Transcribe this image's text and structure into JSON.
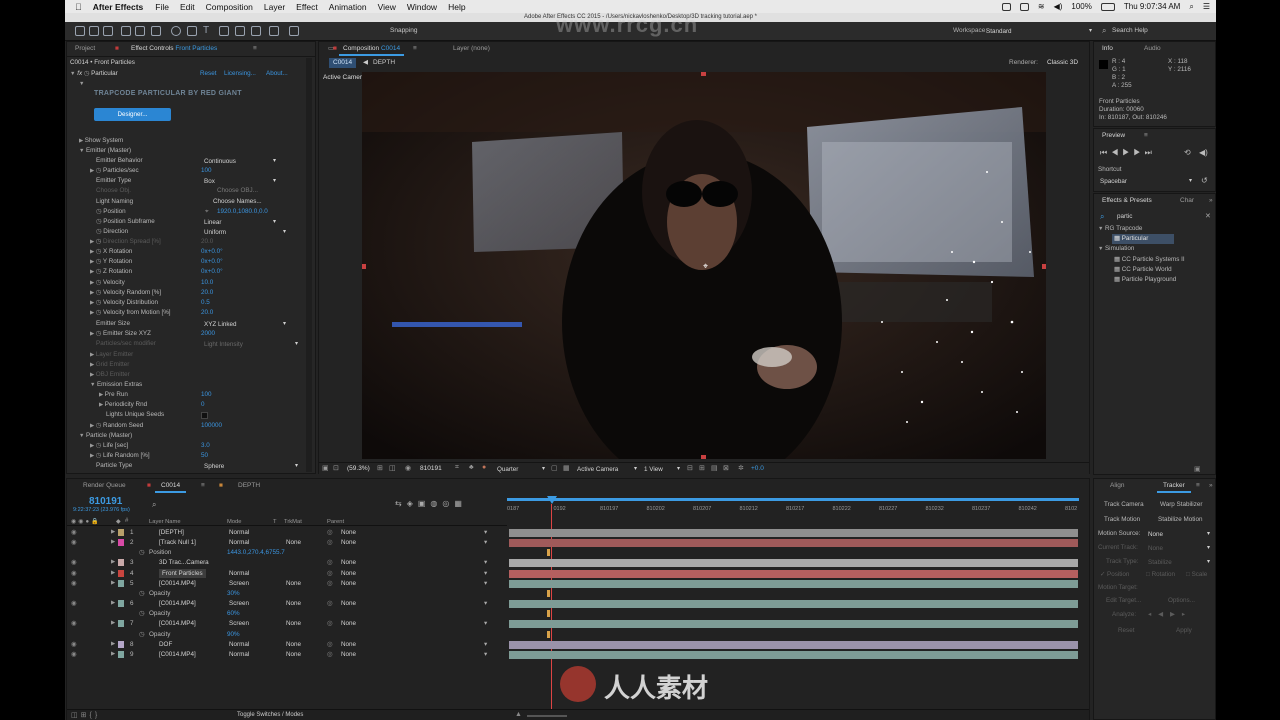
{
  "menubar": {
    "app_name": "After Effects",
    "items": [
      "File",
      "Edit",
      "Composition",
      "Layer",
      "Effect",
      "Animation",
      "View",
      "Window",
      "Help"
    ],
    "battery": "100%",
    "clock": "Thu 9:07:34 AM"
  },
  "window_title": "Adobe After Effects CC 2015 - /Users/nickavloshenko/Desktop/3D tracking tutorial.aep *",
  "watermark": "www.rrcg.cn",
  "toolbar": {
    "snapping_label": "Snapping",
    "workspace_label": "Workspace:",
    "workspace_value": "Standard",
    "search_help": "Search Help"
  },
  "left_panel": {
    "tab_project": "Project",
    "tab_effect_controls": "Effect Controls",
    "tab_effect_target": "Front Particles",
    "breadcrumb": "C0014 • Front Particles",
    "effect_name": "Particular",
    "reset": "Reset",
    "licensing": "Licensing...",
    "about": "About...",
    "brand": "TRAPCODE PARTICULAR BY RED GIANT",
    "designer_button": "Designer...",
    "show_system": "Show System",
    "emitter_master": "Emitter (Master)",
    "emitter_behavior": {
      "label": "Emitter Behavior",
      "value": "Continuous"
    },
    "particles_sec": {
      "label": "Particles/sec",
      "value": "100"
    },
    "emitter_type": {
      "label": "Emitter Type",
      "value": "Box"
    },
    "choose_obj_label": "Choose Obj.",
    "choose_obj_value": "Choose OBJ...",
    "light_naming": "Light Naming",
    "choose_names": "Choose Names...",
    "position": {
      "label": "Position",
      "value": "1920.0,1080.0,0.0"
    },
    "position_subframe": {
      "label": "Position Subframe",
      "value": "Linear"
    },
    "direction": {
      "label": "Direction",
      "value": "Uniform"
    },
    "direction_spread": {
      "label": "Direction Spread [%]",
      "value": "20.0"
    },
    "x_rotation": {
      "label": "X Rotation",
      "value": "0x+0.0°"
    },
    "y_rotation": {
      "label": "Y Rotation",
      "value": "0x+0.0°"
    },
    "z_rotation": {
      "label": "Z Rotation",
      "value": "0x+0.0°"
    },
    "velocity": {
      "label": "Velocity",
      "value": "10.0"
    },
    "velocity_random": {
      "label": "Velocity Random [%]",
      "value": "20.0"
    },
    "velocity_distribution": {
      "label": "Velocity Distribution",
      "value": "0.5"
    },
    "velocity_from_motion": {
      "label": "Velocity from Motion [%]",
      "value": "20.0"
    },
    "emitter_size": {
      "label": "Emitter Size",
      "value": "XYZ Linked"
    },
    "emitter_size_xyz": {
      "label": "Emitter Size XYZ",
      "value": "2000"
    },
    "particles_modifier": {
      "label": "Particles/sec modifier",
      "value": "Light Intensity"
    },
    "layer_emitter": "Layer Emitter",
    "grid_emitter": "Grid Emitter",
    "obj_emitter": "OBJ Emitter",
    "emission_extras": "Emission Extras",
    "pre_run": {
      "label": "Pre Run",
      "value": "100"
    },
    "periodicity_rnd": {
      "label": "Periodicity Rnd",
      "value": "0"
    },
    "lights_unique_seeds": "Lights Unique Seeds",
    "random_seed": {
      "label": "Random Seed",
      "value": "100000"
    },
    "particle_master": "Particle (Master)",
    "life_sec": {
      "label": "Life [sec]",
      "value": "3.0"
    },
    "life_random": {
      "label": "Life Random [%]",
      "value": "50"
    },
    "particle_type": {
      "label": "Particle Type",
      "value": "Sphere"
    }
  },
  "comp_panel": {
    "tab_label": "Composition",
    "tab_comp": "C0014",
    "layer_tab": "Layer (none)",
    "crumb_c0014": "C0014",
    "crumb_depth": "DEPTH",
    "renderer_label": "Renderer:",
    "renderer_value": "Classic 3D",
    "active_camera": "Active Camera",
    "zoom": "(59.3%)",
    "timecode": "810191",
    "resolution": "Quarter",
    "camera_select": "Active Camera",
    "views": "1 View",
    "exposure": "+0.0"
  },
  "info_panel": {
    "tab_info": "Info",
    "tab_audio": "Audio",
    "r": "R : 4",
    "g": "G : 1",
    "b": "B : 2",
    "a": "A : 255",
    "x": "X : 118",
    "y": "Y : 2116",
    "layer_name": "Front Particles",
    "duration": "Duration: 00060",
    "in_out": "In: 810187, Out: 810246"
  },
  "preview_panel": {
    "title": "Preview",
    "shortcut_label": "Shortcut",
    "shortcut_value": "Spacebar"
  },
  "effects_presets": {
    "tab_label": "Effects & Presets",
    "tab_char": "Char",
    "search": "partic",
    "group1": "RG Trapcode",
    "item_particular": "Particular",
    "group2": "Simulation",
    "items": [
      "CC Particle Systems II",
      "CC Particle World",
      "Particle Playground"
    ]
  },
  "tracker_panel": {
    "tab_align": "Align",
    "tab_tracker": "Tracker",
    "track_camera": "Track Camera",
    "warp_stabilizer": "Warp Stabilizer",
    "track_motion": "Track Motion",
    "stabilize_motion": "Stabilize Motion",
    "motion_source_label": "Motion Source:",
    "motion_source_value": "None",
    "current_track_label": "Current Track:",
    "current_track_value": "None",
    "track_type_label": "Track Type:",
    "track_type_value": "Stabilize",
    "position": "Position",
    "rotation": "Rotation",
    "scale": "Scale",
    "motion_target": "Motion Target:",
    "edit_target": "Edit Target...",
    "options": "Options...",
    "analyze": "Analyze:",
    "reset": "Reset",
    "apply": "Apply"
  },
  "timeline": {
    "tab_render_queue": "Render Queue",
    "tab_c0014": "C0014",
    "tab_depth": "DEPTH",
    "timecode": "810191",
    "sub_timecode": "9:22:37:23 (23.976 fps)",
    "col_layer_name": "Layer Name",
    "col_mode": "Mode",
    "col_t": "T",
    "col_trkmat": "TrkMat",
    "col_parent": "Parent",
    "toggle_label": "Toggle Switches / Modes",
    "ruler": [
      "0187",
      "0192",
      "810197",
      "810202",
      "810207",
      "810212",
      "810217",
      "810222",
      "810227",
      "810232",
      "810237",
      "810242",
      "8102"
    ],
    "layers": [
      {
        "num": "1",
        "name": "[DEPTH]",
        "mode": "Normal",
        "trkmat": "",
        "parent": "None",
        "color": "#b8a06a",
        "bar": "#8f8f8f"
      },
      {
        "num": "2",
        "name": "[Track Null 1]",
        "mode": "Normal",
        "trkmat": "None",
        "parent": "None",
        "color": "#d84aa6",
        "bar": "#a05a5a"
      },
      {
        "prop": "Position",
        "value": "1443.0,270.4,6755.7"
      },
      {
        "num": "3",
        "name": "3D Trac...Camera",
        "mode": "",
        "trkmat": "",
        "parent": "None",
        "color": "#c9a9a9",
        "bar": "#a8a8a8"
      },
      {
        "num": "4",
        "name": "Front Particles",
        "mode": "Normal",
        "trkmat": "",
        "parent": "None",
        "color": "#c9453f",
        "bar": "#b55f5f"
      },
      {
        "num": "5",
        "name": "[C0014.MP4]",
        "mode": "Screen",
        "trkmat": "None",
        "parent": "None",
        "color": "#7fa6a0",
        "bar": "#7e9c96"
      },
      {
        "prop": "Opacity",
        "value": "30%"
      },
      {
        "num": "6",
        "name": "[C0014.MP4]",
        "mode": "Screen",
        "trkmat": "None",
        "parent": "None",
        "color": "#7fa6a0",
        "bar": "#7e9c96"
      },
      {
        "prop": "Opacity",
        "value": "60%"
      },
      {
        "num": "7",
        "name": "[C0014.MP4]",
        "mode": "Screen",
        "trkmat": "None",
        "parent": "None",
        "color": "#7fa6a0",
        "bar": "#7e9c96"
      },
      {
        "prop": "Opacity",
        "value": "90%"
      },
      {
        "num": "8",
        "name": "DOF",
        "mode": "Normal",
        "trkmat": "None",
        "parent": "None",
        "color": "#b4a6c8",
        "bar": "#9a92aa"
      },
      {
        "num": "9",
        "name": "[C0014.MP4]",
        "mode": "Normal",
        "trkmat": "None",
        "parent": "None",
        "color": "#7fa6a0",
        "bar": "#7e9c96"
      }
    ]
  },
  "bottom_watermark": "人人素材"
}
